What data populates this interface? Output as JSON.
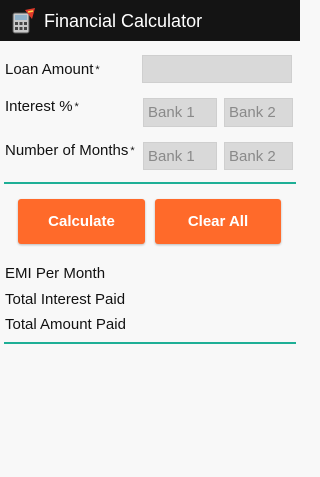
{
  "app": {
    "title": "Financial Calculator",
    "icon": "calculator-icon"
  },
  "form": {
    "loan_amount": {
      "label": "Loan Amount",
      "required_mark": "*",
      "value": "",
      "placeholder": ""
    },
    "interest": {
      "label": "Interest %",
      "required_mark": "*",
      "bank1_placeholder": "Bank 1",
      "bank2_placeholder": "Bank 2"
    },
    "months": {
      "label": "Number of Months",
      "required_mark": "*",
      "bank1_placeholder": "Bank 1",
      "bank2_placeholder": "Bank 2"
    }
  },
  "buttons": {
    "calculate": "Calculate",
    "clear_all": "Clear All"
  },
  "results": {
    "emi_label": "EMI Per Month",
    "total_interest_label": "Total Interest Paid",
    "total_amount_label": "Total Amount Paid"
  },
  "colors": {
    "app_bar": "#141414",
    "accent_line": "#1eaf96",
    "button": "#ff6a2a",
    "field": "#d9d9d9"
  }
}
